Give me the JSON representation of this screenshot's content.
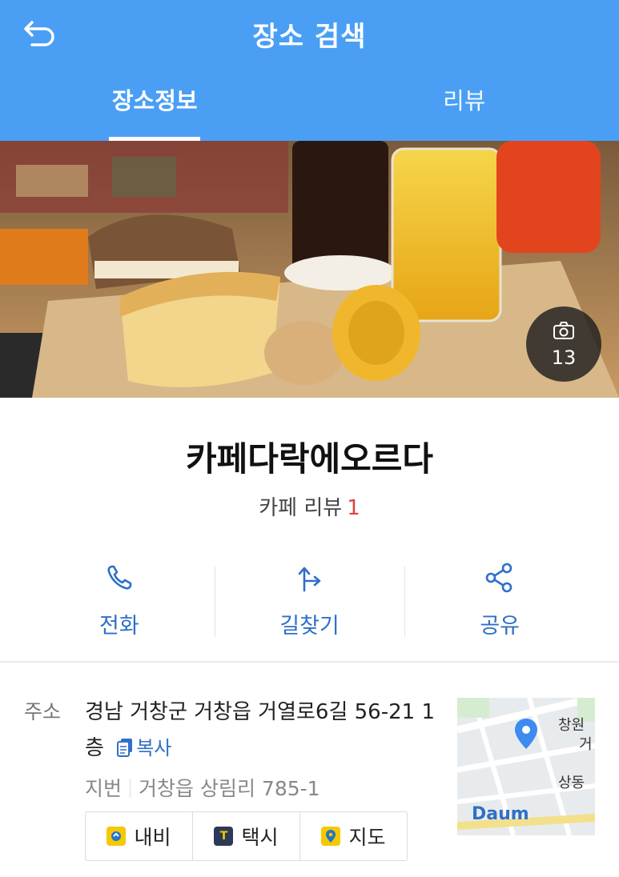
{
  "header": {
    "title": "장소 검색",
    "tabs": [
      {
        "label": "장소정보",
        "active": true
      },
      {
        "label": "리뷰",
        "active": false
      }
    ],
    "accent_color": "#4a9ff5"
  },
  "hero": {
    "photo_count": "13",
    "camera_icon": "camera-icon"
  },
  "place": {
    "name": "카페다락에오르다",
    "category": "카페",
    "review_label": "리뷰",
    "review_count": "1"
  },
  "actions": [
    {
      "label": "전화",
      "icon": "phone-icon"
    },
    {
      "label": "길찾기",
      "icon": "directions-icon"
    },
    {
      "label": "공유",
      "icon": "share-icon"
    }
  ],
  "address": {
    "label": "주소",
    "road": "경남 거창군 거창읍 거열로6길 56-21 1층",
    "copy_label": "복사",
    "jibun_label": "지번",
    "jibun": "거창읍 상림리 785-1"
  },
  "quick_buttons": [
    {
      "label": "내비",
      "icon": "navi-icon",
      "color": "#f5c800"
    },
    {
      "label": "택시",
      "icon": "taxi-icon",
      "color": "#2b3a55"
    },
    {
      "label": "지도",
      "icon": "map-pin-icon",
      "color": "#f5c800"
    }
  ],
  "minimap": {
    "labels": [
      "창원",
      "거",
      "상동"
    ],
    "logo": "Daum"
  }
}
